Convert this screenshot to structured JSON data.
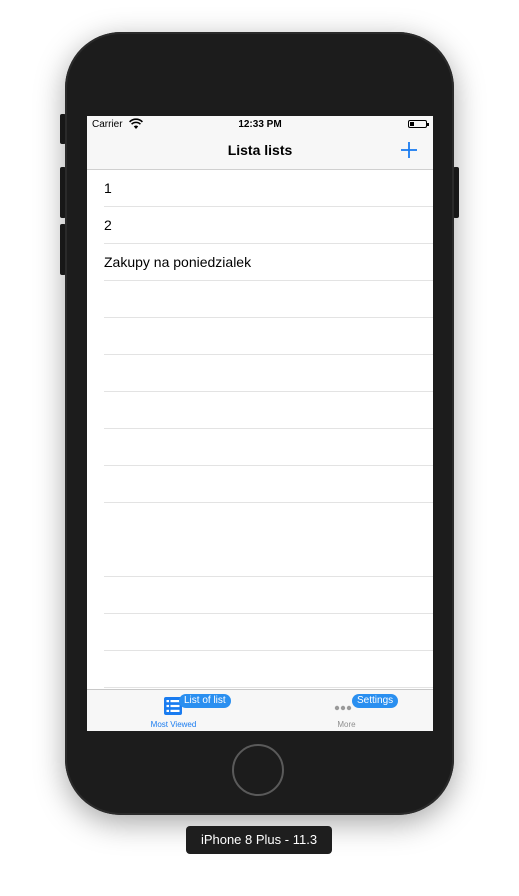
{
  "status_bar": {
    "carrier": "Carrier",
    "time": "12:33 PM"
  },
  "nav": {
    "title": "Lista lists",
    "add_icon": "plus-icon"
  },
  "list": {
    "rows": [
      {
        "label": "1"
      },
      {
        "label": "2"
      },
      {
        "label": "Zakupy na poniedzialek"
      },
      {
        "label": ""
      },
      {
        "label": ""
      },
      {
        "label": ""
      },
      {
        "label": ""
      },
      {
        "label": ""
      },
      {
        "label": ""
      },
      {
        "label": ""
      },
      {
        "label": ""
      },
      {
        "label": ""
      },
      {
        "label": ""
      },
      {
        "label": ""
      }
    ]
  },
  "tabs": [
    {
      "label": "Most Viewed",
      "badge": "List of list",
      "icon": "list-icon"
    },
    {
      "label": "More",
      "badge": "Settings",
      "icon": "more-icon"
    }
  ],
  "device_label": "iPhone 8 Plus - 11.3",
  "colors": {
    "accent": "#1a7cf0",
    "badge": "#2a8ff0",
    "device": "#1c1c1c"
  }
}
